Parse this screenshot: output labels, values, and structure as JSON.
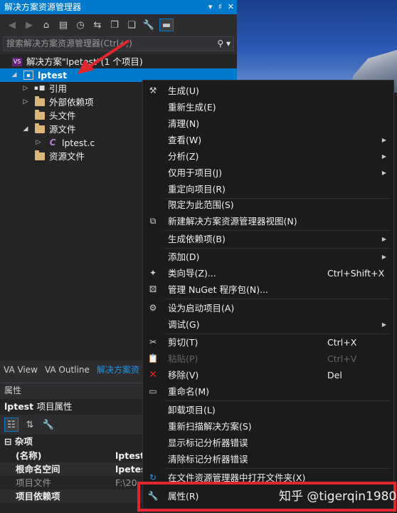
{
  "solution_explorer": {
    "title": "解决方案资源管理器",
    "title_buttons": [
      "▾",
      "♯",
      "✕"
    ],
    "search_placeholder": "搜索解决方案资源管理器(Ctrl+;)",
    "tree": {
      "solution": "解决方案\"lpetest\"(1 个项目)",
      "project": "lptest",
      "references": "引用",
      "external_deps": "外部依赖项",
      "headers": "头文件",
      "sources": "源文件",
      "source_file": "lptest.c",
      "resources": "资源文件"
    },
    "tabs": [
      "VA View",
      "VA Outline",
      "解决方案资"
    ]
  },
  "properties": {
    "title": "属性",
    "object_name": "lptest",
    "object_type": "项目属性",
    "category": "杂项",
    "rows": [
      {
        "name": "(名称)",
        "value": "lptest"
      },
      {
        "name": "根命名空间",
        "value": "lpetest"
      },
      {
        "name": "项目文件",
        "value": "F:\\20"
      },
      {
        "name": "项目依赖项",
        "value": ""
      }
    ]
  },
  "context_menu": {
    "items": [
      {
        "label": "生成(U)",
        "icon": "build-icon"
      },
      {
        "label": "重新生成(E)"
      },
      {
        "label": "清理(N)"
      },
      {
        "label": "查看(W)",
        "submenu": true
      },
      {
        "label": "分析(Z)",
        "submenu": true
      },
      {
        "label": "仅用于项目(J)",
        "submenu": true
      },
      {
        "label": "重定向项目(R)"
      },
      {
        "label": "限定为此范围(S)"
      },
      {
        "label": "新建解决方案资源管理器视图(N)",
        "icon": "new-view-icon"
      },
      {
        "label": "生成依赖项(B)",
        "submenu": true
      },
      {
        "label": "添加(D)",
        "submenu": true
      },
      {
        "label": "类向导(Z)...",
        "shortcut": "Ctrl+Shift+X",
        "icon": "class-wizard-icon"
      },
      {
        "label": "管理 NuGet 程序包(N)...",
        "icon": "nuget-icon"
      },
      {
        "label": "设为启动项目(A)",
        "icon": "gear-icon"
      },
      {
        "label": "调试(G)",
        "submenu": true
      },
      {
        "label": "剪切(T)",
        "shortcut": "Ctrl+X",
        "icon": "scissors-icon"
      },
      {
        "label": "粘贴(P)",
        "shortcut": "Ctrl+V",
        "disabled": true,
        "icon": "paste-icon"
      },
      {
        "label": "移除(V)",
        "shortcut": "Del",
        "icon": "remove-icon"
      },
      {
        "label": "重命名(M)",
        "icon": "rename-icon"
      },
      {
        "label": "卸载项目(L)"
      },
      {
        "label": "重新扫描解决方案(S)"
      },
      {
        "label": "显示标记分析器错误"
      },
      {
        "label": "清除标记分析器错误"
      },
      {
        "label": "在文件资源管理器中打开文件夹(X)",
        "icon": "refresh-icon"
      },
      {
        "label": "属性(R)",
        "icon": "wrench-icon"
      }
    ]
  },
  "watermark": "知乎 @tigerqin1980",
  "colors": {
    "accent": "#007acc",
    "highlight": "#e0272d",
    "menu_bg": "#1b1b1c"
  }
}
